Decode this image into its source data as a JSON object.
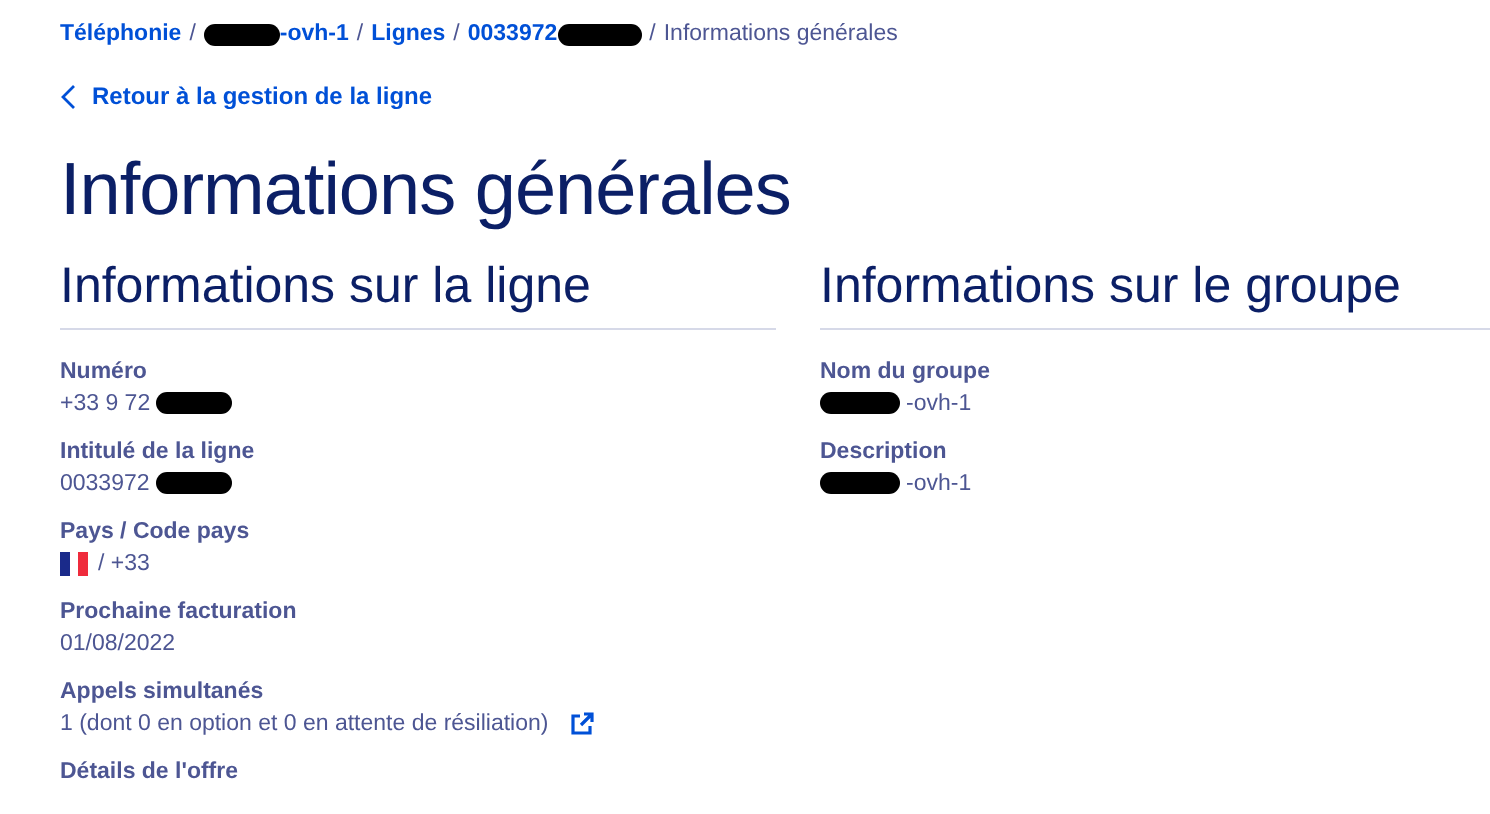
{
  "breadcrumb": [
    {
      "segments": [
        {
          "kind": "text",
          "text": "Téléphonie"
        }
      ],
      "link": true,
      "separator": "/"
    },
    {
      "segments": [
        {
          "kind": "redacted"
        },
        {
          "kind": "text",
          "text": "-ovh-1"
        }
      ],
      "link": true,
      "separator": "/"
    },
    {
      "segments": [
        {
          "kind": "text",
          "text": "Lignes"
        }
      ],
      "link": true,
      "separator": "/"
    },
    {
      "segments": [
        {
          "kind": "text",
          "text": "0033972"
        },
        {
          "kind": "redacted"
        }
      ],
      "link": true,
      "separator": "/"
    },
    {
      "segments": [
        {
          "kind": "text",
          "text": "Informations générales"
        }
      ],
      "link": false
    }
  ],
  "back_link": "Retour à la gestion de la ligne",
  "title": "Informations générales",
  "sections": [
    {
      "heading": "Informations sur la ligne",
      "fields": [
        {
          "label": "Numéro",
          "value": [
            {
              "kind": "text",
              "text": "+33 9 72"
            },
            {
              "kind": "redacted"
            }
          ]
        },
        {
          "label": "Intitulé de la ligne",
          "value": [
            {
              "kind": "text",
              "text": "0033972"
            },
            {
              "kind": "redacted"
            }
          ]
        },
        {
          "label": "Pays / Code pays",
          "value": [
            {
              "kind": "flag"
            },
            {
              "kind": "text",
              "text": "/ +33"
            }
          ]
        },
        {
          "label": "Prochaine facturation",
          "value": [
            {
              "kind": "text",
              "text": "01/08/2022"
            }
          ]
        },
        {
          "label": "Appels simultanés",
          "value": [
            {
              "kind": "text",
              "text": "1 (dont 0 en option et 0 en attente de résiliation)"
            },
            {
              "kind": "external_link"
            }
          ]
        },
        {
          "label": "Détails de l'offre"
        }
      ]
    },
    {
      "heading": "Informations sur le groupe",
      "fields": [
        {
          "label": "Nom du groupe",
          "value": [
            {
              "kind": "redacted"
            },
            {
              "kind": "text",
              "text": "-ovh-1"
            }
          ]
        },
        {
          "label": "Description",
          "value": [
            {
              "kind": "redacted"
            },
            {
              "kind": "text",
              "text": "-ovh-1"
            }
          ]
        }
      ]
    }
  ]
}
